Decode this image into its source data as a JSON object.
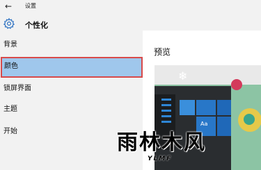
{
  "window": {
    "title": "设置"
  },
  "header": {
    "title": "个性化",
    "icon": "gear-icon"
  },
  "sidebar": {
    "items": [
      {
        "label": "背景"
      },
      {
        "label": "颜色"
      },
      {
        "label": "锁屏界面"
      },
      {
        "label": "主题"
      },
      {
        "label": "开始"
      }
    ],
    "selected": "颜色"
  },
  "main": {
    "title": "预览",
    "preview_tile_text": "Aa"
  },
  "watermark": {
    "main": "雨林木风",
    "sub": "YLMF"
  },
  "colors": {
    "selection": "#9fc7ec",
    "highlight_border": "#d84a4a",
    "accent_blue": "#2877c8"
  }
}
